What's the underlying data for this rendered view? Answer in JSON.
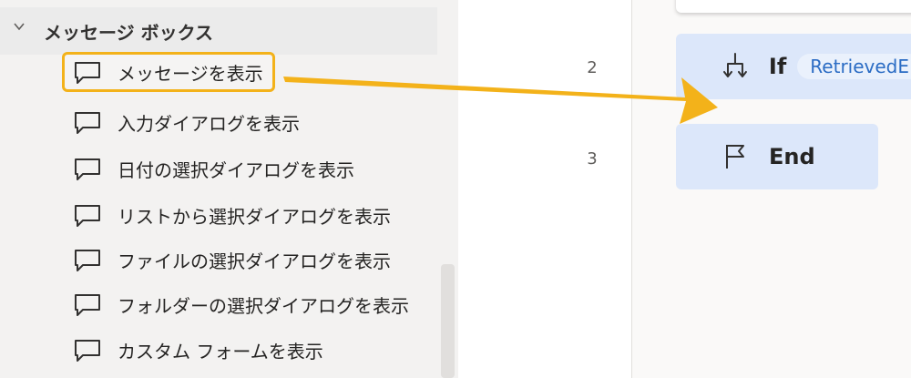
{
  "actions_panel": {
    "group_title": "メッセージ ボックス",
    "items": [
      {
        "label": "メッセージを表示",
        "highlighted": true
      },
      {
        "label": "入力ダイアログを表示"
      },
      {
        "label": "日付の選択ダイアログを表示"
      },
      {
        "label": "リストから選択ダイアログを表示"
      },
      {
        "label": "ファイルの選択ダイアログを表示"
      },
      {
        "label": "フォルダーの選択ダイアログを表示"
      },
      {
        "label": "カスタム フォームを表示"
      }
    ],
    "item_icon": "message-box-icon",
    "highlight_color": "#f3b21a"
  },
  "flow": {
    "line_numbers": [
      "2",
      "3"
    ],
    "steps": [
      {
        "keyword": "If",
        "variable": "RetrievedE",
        "icon": "if-branch-icon"
      },
      {
        "keyword": "End",
        "icon": "end-flag-icon"
      }
    ],
    "step_color": "#dce7fa",
    "variable_color": "#2b6cc4"
  },
  "annotation": {
    "arrow_color": "#f3b21a"
  }
}
